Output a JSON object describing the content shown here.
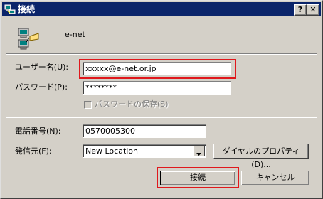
{
  "window": {
    "title": "接続",
    "help_label": "?",
    "close_label": "✕"
  },
  "connection": {
    "name": "e-net"
  },
  "form": {
    "username_label": "ユーザー名(U):",
    "username_value": "xxxxx@e-net.or.jp",
    "password_label": "パスワード(P):",
    "password_value": "********",
    "save_password_label": "パスワードの保存(S)",
    "save_password_checked": false,
    "phone_label": "電話番号(N):",
    "phone_value": "0570005300",
    "dial_from_label": "発信元(F):",
    "dial_from_value": "New Location",
    "dial_properties_label": "ダイヤルのプロパティ(D)..."
  },
  "buttons": {
    "connect_label": "接続",
    "cancel_label": "キャンセル"
  },
  "colors": {
    "title_bar": "#0a246a",
    "highlight_box": "#e0181c",
    "dialog_face": "#d4d0c8"
  },
  "icons": {
    "title": "network-connection-icon",
    "connection": "network-computers-icon"
  }
}
